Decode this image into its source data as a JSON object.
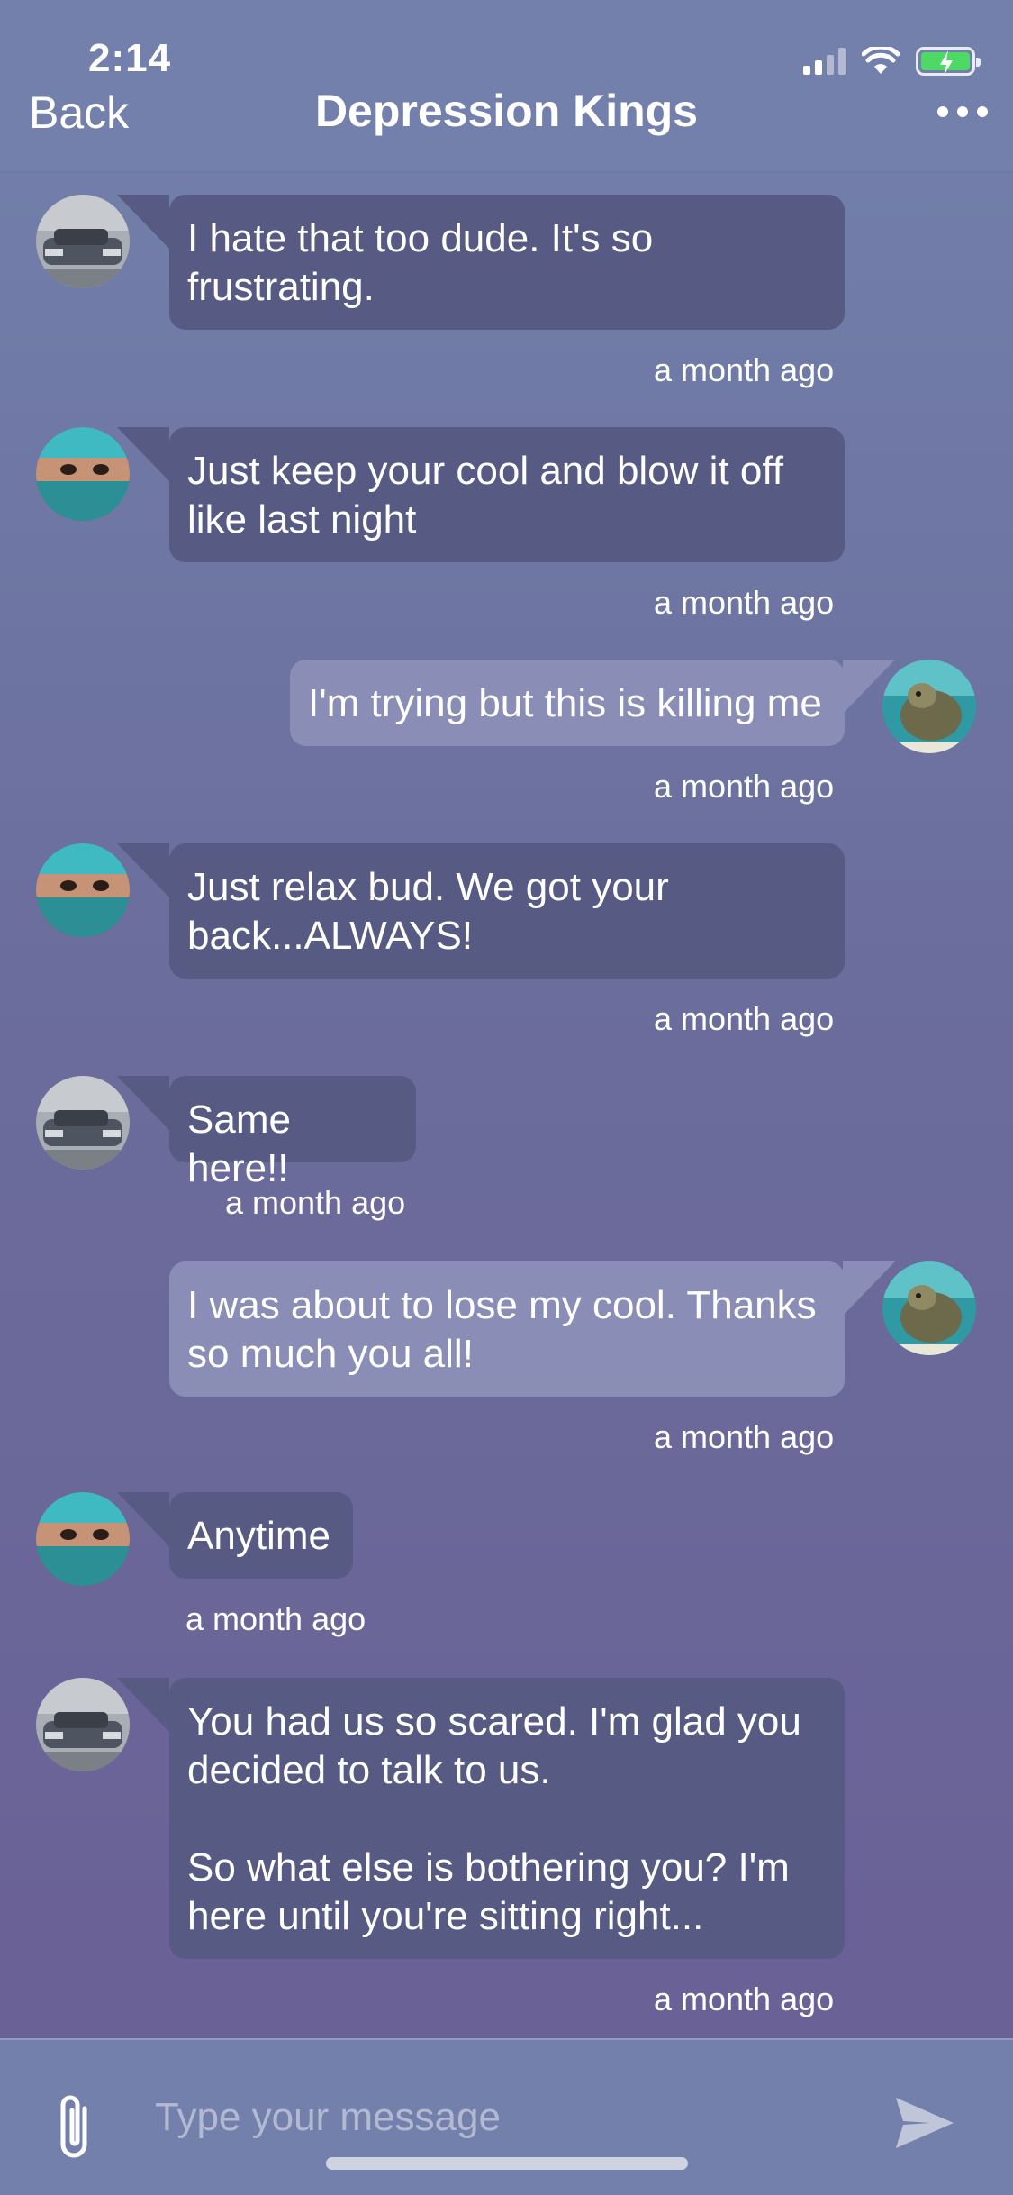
{
  "status_bar": {
    "time": "2:14"
  },
  "nav": {
    "back_label": "Back",
    "title": "Depression Kings",
    "more_icon": "ellipsis-icon"
  },
  "messages": [
    {
      "sender": "car",
      "direction": "in",
      "text": "I hate that too dude. It's so\nfrustrating.",
      "time": "a month ago"
    },
    {
      "sender": "masked",
      "direction": "in",
      "text": "Just keep your cool and blow it off\nlike last night",
      "time": "a month ago"
    },
    {
      "sender": "me-turtle",
      "direction": "out",
      "text": "I'm trying but this is killing me",
      "time": "a month ago"
    },
    {
      "sender": "masked",
      "direction": "in",
      "text": "Just relax bud. We got your\nback...ALWAYS!",
      "time": "a month ago"
    },
    {
      "sender": "car",
      "direction": "in",
      "text": "Same here!!",
      "time": "a month ago"
    },
    {
      "sender": "me-turtle",
      "direction": "out",
      "text": "I was about to lose my cool. Thanks\nso much you all!",
      "time": "a month ago"
    },
    {
      "sender": "masked",
      "direction": "in",
      "text": "Anytime",
      "time": "a month ago"
    },
    {
      "sender": "car",
      "direction": "in",
      "text": "You had us so scared. I'm glad you\ndecided to talk to us.\n\nSo what else is bothering you? I'm\nhere until you're sitting right...",
      "time": "a month ago"
    }
  ],
  "composer": {
    "placeholder": "Type your message",
    "attach_icon": "paperclip-icon",
    "send_icon": "send-icon"
  },
  "colors": {
    "header": "#7480ac",
    "bubble_in": "#575a83",
    "bubble_out": "#8a8db6",
    "battery": "#4cd964"
  }
}
